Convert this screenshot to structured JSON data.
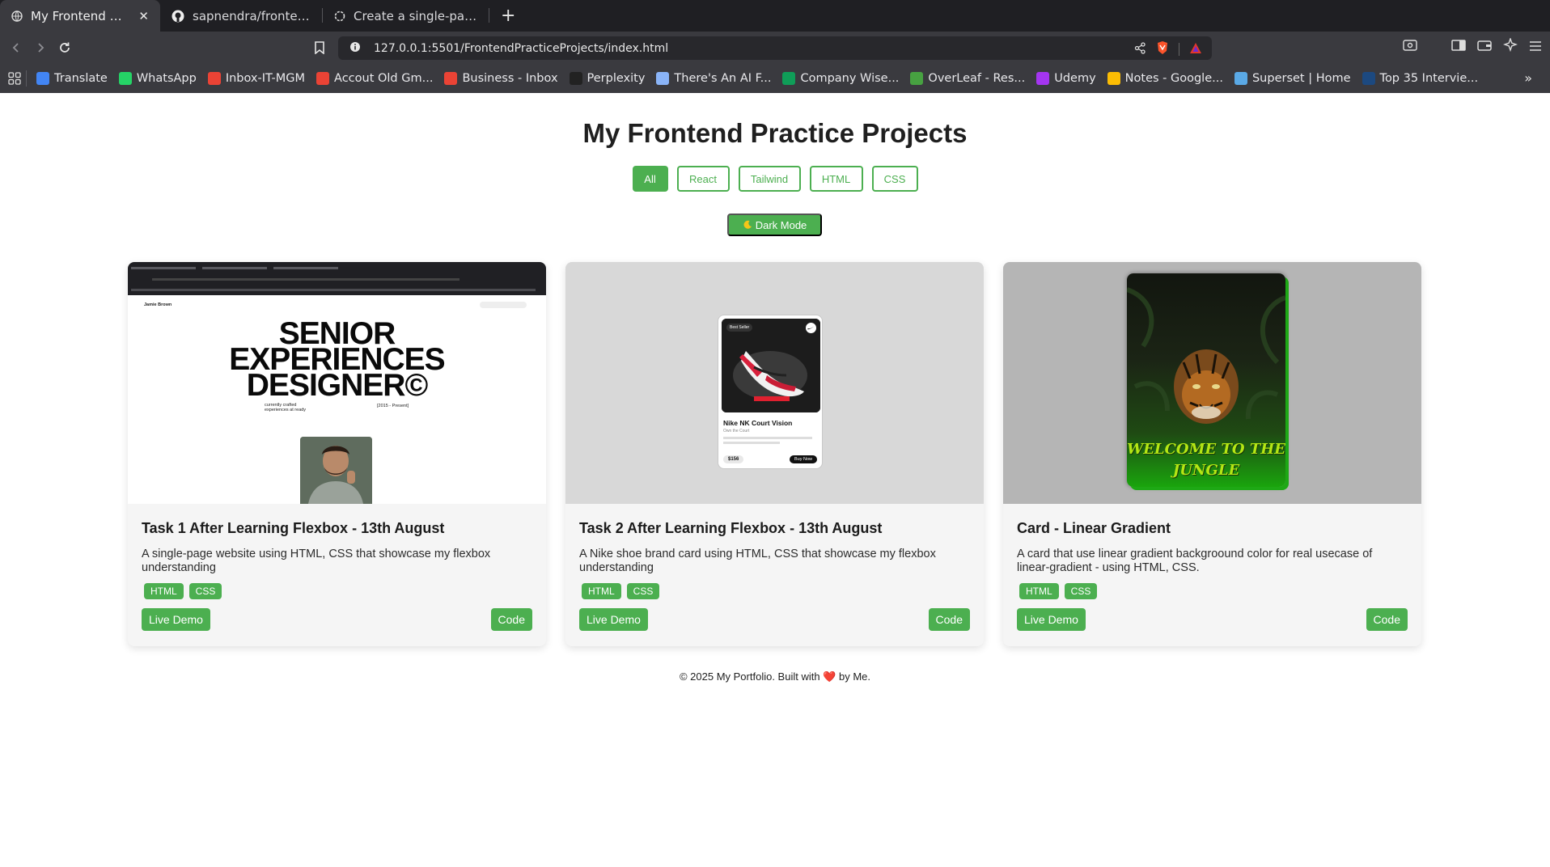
{
  "browser": {
    "tabs": [
      {
        "title": "My Frontend Practice Pro",
        "active": true
      },
      {
        "title": "sapnendra/frontendpractice",
        "active": false
      },
      {
        "title": "Create a single-page portfolio",
        "active": false
      }
    ],
    "url": "127.0.0.1:5501/FrontendPracticeProjects/index.html",
    "bookmarks": [
      {
        "label": "Translate",
        "icon": "google-translate-icon",
        "color": "#4285f4"
      },
      {
        "label": "WhatsApp",
        "icon": "whatsapp-icon",
        "color": "#25d366"
      },
      {
        "label": "Inbox-IT-MGM",
        "icon": "gmail-icon",
        "color": "#ea4335"
      },
      {
        "label": "Accout Old Gm...",
        "icon": "gmail-icon",
        "color": "#ea4335"
      },
      {
        "label": "Business - Inbox",
        "icon": "gmail-icon",
        "color": "#ea4335"
      },
      {
        "label": "Perplexity",
        "icon": "perplexity-icon",
        "color": "#222222"
      },
      {
        "label": "There's An AI F...",
        "icon": "ai-icon",
        "color": "#8ab4f8"
      },
      {
        "label": "Company Wise...",
        "icon": "sheets-icon",
        "color": "#0f9d58"
      },
      {
        "label": "OverLeaf - Res...",
        "icon": "overleaf-icon",
        "color": "#47a141"
      },
      {
        "label": "Udemy",
        "icon": "udemy-icon",
        "color": "#a435f0"
      },
      {
        "label": "Notes - Google...",
        "icon": "drive-icon",
        "color": "#fbbc04"
      },
      {
        "label": "Superset | Home",
        "icon": "superset-icon",
        "color": "#5aa9e6"
      },
      {
        "label": "Top 35 Intervie...",
        "icon": "unstop-icon",
        "color": "#1c4980"
      }
    ]
  },
  "page": {
    "title": "My Frontend Practice Projects",
    "filters": [
      {
        "label": "All",
        "active": true
      },
      {
        "label": "React",
        "active": false
      },
      {
        "label": "Tailwind",
        "active": false
      },
      {
        "label": "HTML",
        "active": false
      },
      {
        "label": "CSS",
        "active": false
      }
    ],
    "dark_mode_label": "Dark Mode",
    "accent": "#4caf50",
    "projects": [
      {
        "title": "Task 1 After Learning Flexbox - 13th August",
        "description": "A single-page website using HTML, CSS that showcase my flexbox understanding",
        "tags": [
          "HTML",
          "CSS"
        ],
        "live_label": "Live Demo",
        "code_label": "Code",
        "preview": {
          "brand": "Jamie Brown",
          "headline_lines": [
            "SENIOR",
            "EXPERIENCES",
            "DESIGNER©"
          ],
          "caption": "currently crafted experiences at ready",
          "years": "[2015 - Present]"
        }
      },
      {
        "title": "Task 2 After Learning Flexbox - 13th August",
        "description": "A Nike shoe brand card using HTML, CSS that showcase my flexbox understanding",
        "tags": [
          "HTML",
          "CSS"
        ],
        "live_label": "Live Demo",
        "code_label": "Code",
        "preview": {
          "badge": "Best Seller",
          "name": "Nike NK Court Vision",
          "subtitle": "Own the Court",
          "price": "$156",
          "buy": "Buy Now"
        }
      },
      {
        "title": "Card - Linear Gradient",
        "description": "A card that use linear gradient backgroound color for real usecase of linear-gradient - using HTML, CSS.",
        "tags": [
          "HTML",
          "CSS"
        ],
        "live_label": "Live Demo",
        "code_label": "Code",
        "preview": {
          "text_lines": [
            "WELCOME TO THE",
            "JUNGLE"
          ]
        }
      }
    ],
    "footer": {
      "before": "© 2025 My Portfolio. Built with",
      "after": "by Me."
    }
  }
}
